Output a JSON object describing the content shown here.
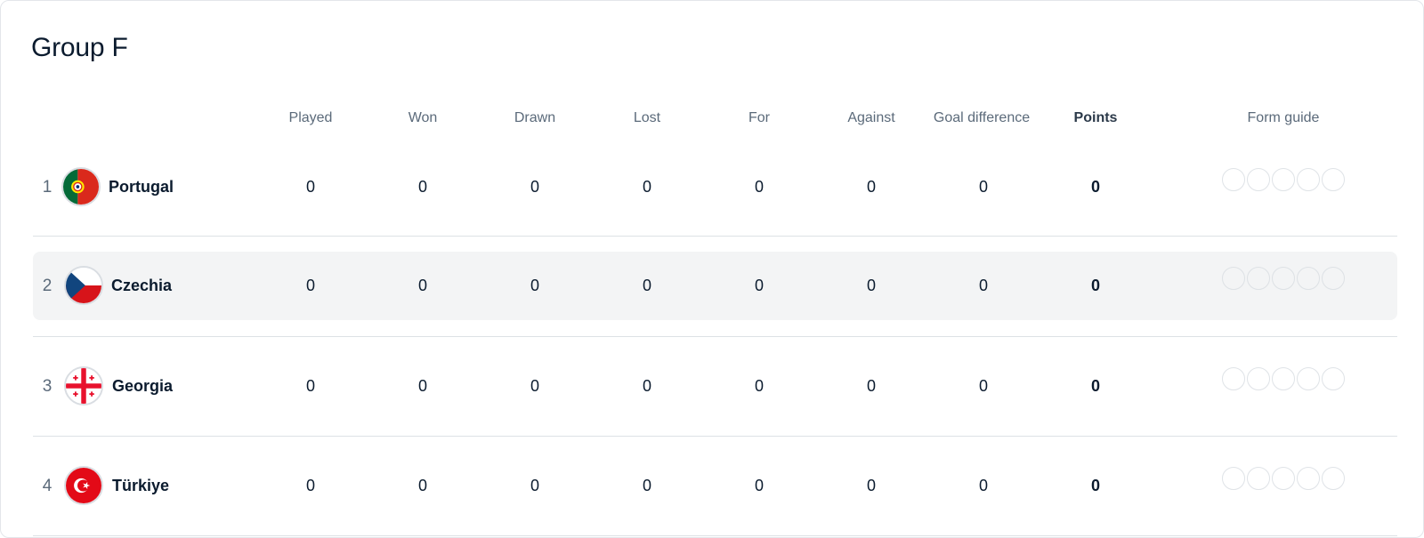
{
  "group": {
    "title": "Group F"
  },
  "columns": {
    "played": "Played",
    "won": "Won",
    "drawn": "Drawn",
    "lost": "Lost",
    "for": "For",
    "against": "Against",
    "goal_difference": "Goal difference",
    "points": "Points",
    "form_guide": "Form guide"
  },
  "teams": [
    {
      "rank": "1",
      "name": "Portugal",
      "flag": "portugal-flag-icon",
      "played": "0",
      "won": "0",
      "drawn": "0",
      "lost": "0",
      "for": "0",
      "against": "0",
      "goal_difference": "0",
      "points": "0"
    },
    {
      "rank": "2",
      "name": "Czechia",
      "flag": "czechia-flag-icon",
      "played": "0",
      "won": "0",
      "drawn": "0",
      "lost": "0",
      "for": "0",
      "against": "0",
      "goal_difference": "0",
      "points": "0"
    },
    {
      "rank": "3",
      "name": "Georgia",
      "flag": "georgia-flag-icon",
      "played": "0",
      "won": "0",
      "drawn": "0",
      "lost": "0",
      "for": "0",
      "against": "0",
      "goal_difference": "0",
      "points": "0"
    },
    {
      "rank": "4",
      "name": "Türkiye",
      "flag": "turkiye-flag-icon",
      "played": "0",
      "won": "0",
      "drawn": "0",
      "lost": "0",
      "for": "0",
      "against": "0",
      "goal_difference": "0",
      "points": "0"
    }
  ],
  "colors": {
    "row_highlight": "#f3f4f5",
    "divider": "#dde1e5",
    "text_primary": "#0b1b2e",
    "text_secondary": "#5b6a7a"
  }
}
